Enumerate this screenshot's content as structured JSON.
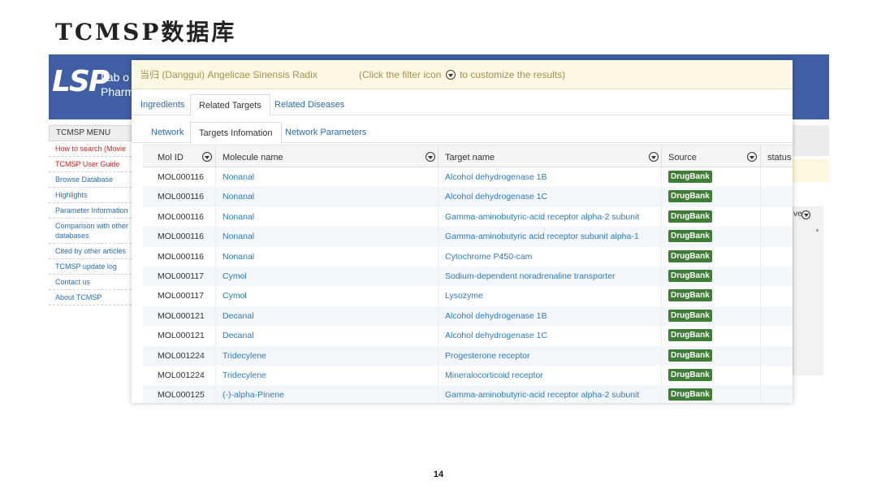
{
  "slide": {
    "title": "TCMSP数据库",
    "page_number": "14"
  },
  "site": {
    "logo_text": "LSP",
    "lab_text": "Lab o\nPharm",
    "menu_title": "TCMSP MENU",
    "menu_items": [
      {
        "label": "How to search (Movie",
        "color": "#d02222"
      },
      {
        "label": "TCMSP User Guide",
        "color": "#d02222"
      },
      {
        "label": "Browse Database"
      },
      {
        "label": "Highlights"
      },
      {
        "label": "Parameter Information"
      },
      {
        "label": "Comparison with other databases"
      },
      {
        "label": "Cited by other articles"
      },
      {
        "label": "TCMSP update log"
      },
      {
        "label": "Contact us"
      },
      {
        "label": "About TCMSP"
      }
    ],
    "partial_column_label": "ve",
    "header_color": "#3f5ea4"
  },
  "panel": {
    "title": "当归 (Danggui) Angelicae Sinensis Radix",
    "hint_before": "(Click the filter icon",
    "hint_after": "to customize the results)",
    "tabs": [
      {
        "label": "Ingredients",
        "active": false
      },
      {
        "label": "Related Targets",
        "active": true
      },
      {
        "label": "Related Diseases",
        "active": false
      }
    ],
    "subtabs": [
      {
        "label": "Network",
        "active": false
      },
      {
        "label": "Targets Infomation",
        "active": true
      },
      {
        "label": "Network Parameters",
        "active": false
      }
    ]
  },
  "table": {
    "columns": [
      "Mol ID",
      "Molecule name",
      "Target name",
      "Source",
      "status"
    ],
    "rows": [
      {
        "mol_id": "MOL000116",
        "molecule": "Nonanal",
        "target": "Alcohol dehydrogenase 1B",
        "source": "DrugBank"
      },
      {
        "mol_id": "MOL000116",
        "molecule": "Nonanal",
        "target": "Alcohol dehydrogenase 1C",
        "source": "DrugBank"
      },
      {
        "mol_id": "MOL000116",
        "molecule": "Nonanal",
        "target": "Gamma-aminobutyric-acid receptor alpha-2 subunit",
        "source": "DrugBank"
      },
      {
        "mol_id": "MOL000116",
        "molecule": "Nonanal",
        "target": "Gamma-aminobutyric acid receptor subunit alpha-1",
        "source": "DrugBank"
      },
      {
        "mol_id": "MOL000116",
        "molecule": "Nonanal",
        "target": "Cytochrome P450-cam",
        "source": "DrugBank"
      },
      {
        "mol_id": "MOL000117",
        "molecule": "Cymol",
        "target": "Sodium-dependent noradrenaline transporter",
        "source": "DrugBank"
      },
      {
        "mol_id": "MOL000117",
        "molecule": "Cymol",
        "target": "Lysozyme",
        "source": "DrugBank"
      },
      {
        "mol_id": "MOL000121",
        "molecule": "Decanal",
        "target": "Alcohol dehydrogenase 1B",
        "source": "DrugBank"
      },
      {
        "mol_id": "MOL000121",
        "molecule": "Decanal",
        "target": "Alcohol dehydrogenase 1C",
        "source": "DrugBank"
      },
      {
        "mol_id": "MOL001224",
        "molecule": "Tridecylene",
        "target": "Progesterone receptor",
        "source": "DrugBank"
      },
      {
        "mol_id": "MOL001224",
        "molecule": "Tridecylene",
        "target": "Mineralocorticoid receptor",
        "source": "DrugBank"
      },
      {
        "mol_id": "MOL000125",
        "molecule": "(-)-alpha-Pinene",
        "target": "Gamma-aminobutyric-acid receptor alpha-2 subunit",
        "source": "DrugBank"
      }
    ],
    "badge_color": "#3d7d35",
    "link_color": "#2c7ac0"
  }
}
